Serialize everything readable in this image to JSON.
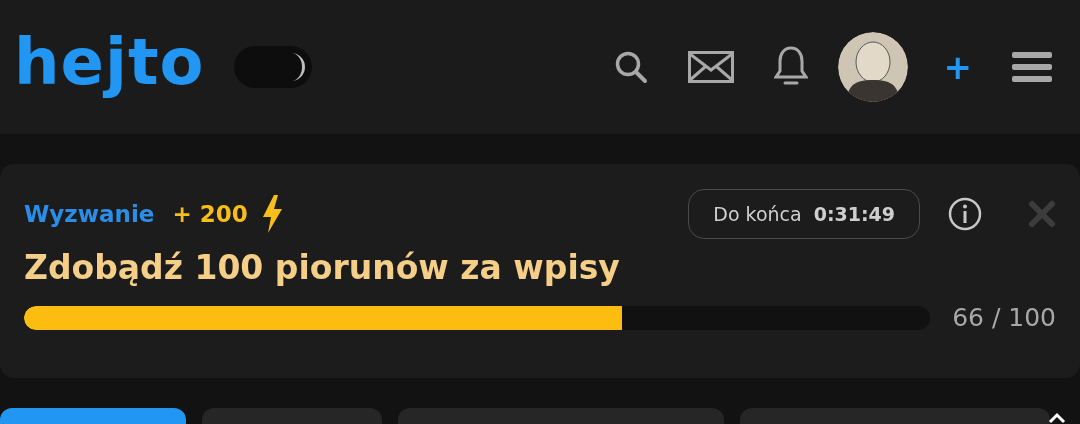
{
  "header": {
    "logo": "hejto",
    "dark_mode": true,
    "add_label": "+"
  },
  "challenge": {
    "label": "Wyzwanie",
    "reward": "+ 200",
    "timer_label": "Do końca",
    "timer_value": "0:31:49",
    "title": "Zdobądź 100 piorunów za wpisy",
    "level": 0.66,
    "progress_text": "66 / 100"
  },
  "categories": [
    {
      "selected": true
    },
    {
      "selected": false
    },
    {
      "selected": false
    },
    {
      "selected": false
    }
  ]
}
